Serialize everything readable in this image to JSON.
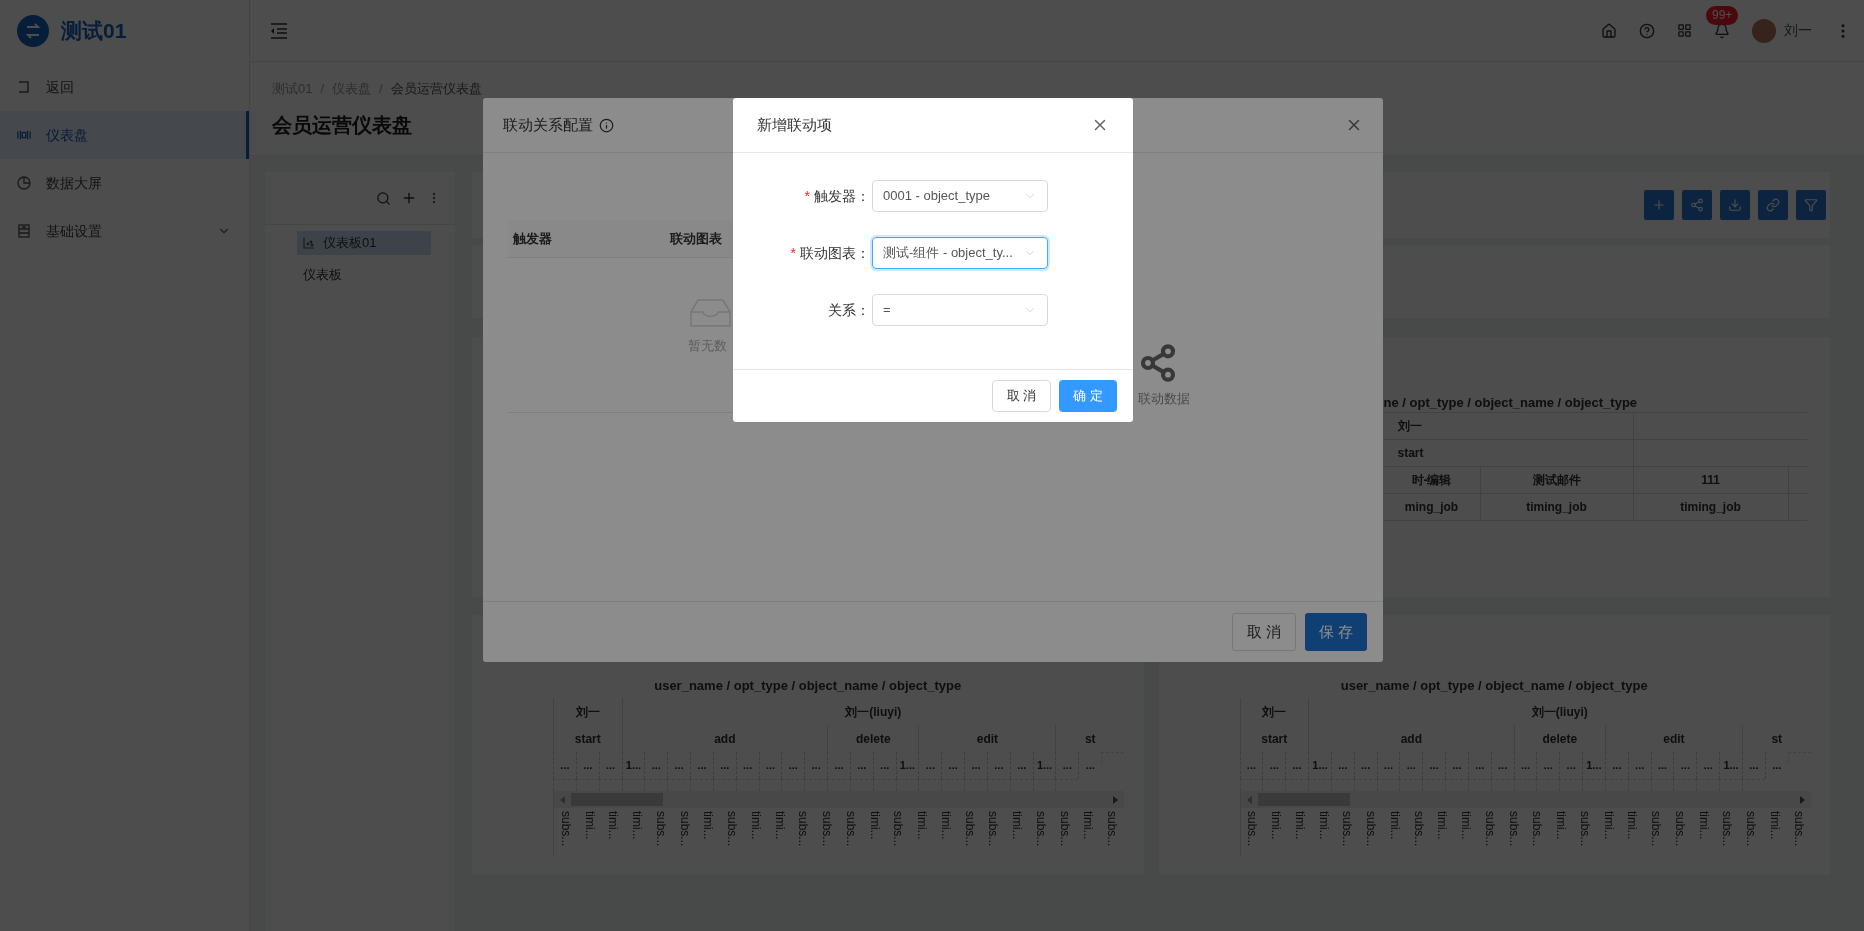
{
  "sidebar": {
    "logo": "测试01",
    "items": [
      {
        "label": "返回",
        "selected": false,
        "has_submenu": false
      },
      {
        "label": "仪表盘",
        "selected": true,
        "has_submenu": false
      },
      {
        "label": "数据大屏",
        "selected": false,
        "has_submenu": false
      },
      {
        "label": "基础设置",
        "selected": false,
        "has_submenu": true
      }
    ]
  },
  "header": {
    "notification_badge": "99+",
    "user_name": "刘一"
  },
  "breadcrumb": [
    {
      "label": "测试01"
    },
    {
      "separator": "/",
      "label": "仪表盘"
    },
    {
      "separator": "/",
      "label": "会员运营仪表盘"
    }
  ],
  "page_title": "会员运营仪表盘",
  "tree": {
    "items": [
      {
        "label": "仪表板01",
        "kind": "dashboard",
        "selected": true
      },
      {
        "label": "仪表板",
        "kind": "folder",
        "selected": false
      }
    ]
  },
  "top_right_chart": {
    "title": "ne / opt_type / object_name / object_type",
    "rows": [
      [
        "刘一"
      ],
      [
        "start"
      ],
      [
        "时-编辑",
        "测试邮件",
        "111"
      ],
      [
        "ming_job",
        "timing_job",
        "timing_job"
      ]
    ]
  },
  "pivot_tables": [
    {
      "title": "user_name / opt_type / object_name / object_type",
      "level_1": [
        "刘一",
        "刘一(liuyi)"
      ],
      "level_2": [
        "start",
        "add",
        "delete",
        "edit",
        "st"
      ],
      "level_3": [
        "...",
        "...",
        "...",
        "1...",
        "...",
        "...",
        "...",
        "...",
        "...",
        "...",
        "...",
        "...",
        "...",
        "...",
        "...",
        "1...",
        "...",
        "...",
        "...",
        "...",
        "...",
        "1...",
        "...",
        "..."
      ],
      "row_labels": [
        "subs...",
        "timi...",
        "timi...",
        "timi...",
        "subs...",
        "subs...",
        "timi...",
        "subs...",
        "timi...",
        "timi...",
        "subs...",
        "subs...",
        "subs...",
        "timi...",
        "subs...",
        "timi...",
        "timi...",
        "subs...",
        "subs...",
        "timi...",
        "subs...",
        "subs...",
        "timi...",
        "subs..."
      ]
    },
    {
      "title": "user_name / opt_type / object_name / object_type",
      "level_1": [
        "刘一",
        "刘一(liuyi)"
      ],
      "level_2": [
        "start",
        "add",
        "delete",
        "edit",
        "st"
      ],
      "level_3": [
        "...",
        "...",
        "...",
        "1...",
        "...",
        "...",
        "...",
        "...",
        "...",
        "...",
        "...",
        "...",
        "...",
        "...",
        "...",
        "1...",
        "...",
        "...",
        "...",
        "...",
        "...",
        "1...",
        "...",
        "..."
      ],
      "row_labels": [
        "subs...",
        "timi...",
        "timi...",
        "timi...",
        "subs...",
        "subs...",
        "timi...",
        "subs...",
        "timi...",
        "timi...",
        "subs...",
        "subs...",
        "subs...",
        "timi...",
        "subs...",
        "timi...",
        "timi...",
        "subs...",
        "subs...",
        "timi...",
        "subs...",
        "subs...",
        "timi...",
        "subs..."
      ]
    }
  ],
  "link_config_dialog": {
    "title": "联动关系配置",
    "columns": [
      "触发器",
      "联动图表"
    ],
    "empty_text": "暂无数",
    "right_empty_text": "联动数据",
    "buttons": [
      {
        "label": "取 消",
        "kind": "default"
      },
      {
        "label": "保 存",
        "kind": "primary"
      }
    ]
  },
  "add_link_dialog": {
    "title": "新增联动项",
    "fields": [
      {
        "required_mark": "*",
        "label": "触发器：",
        "value": "0001 - object_type",
        "focused": false
      },
      {
        "required_mark": "*",
        "label": "联动图表：",
        "value": "测试-组件 - object_ty...",
        "focused": true
      },
      {
        "label": "关系：",
        "value": "=",
        "focused": false
      }
    ],
    "buttons": [
      {
        "label": "取 消",
        "kind": "default"
      },
      {
        "label": "确 定",
        "kind": "primary"
      }
    ]
  }
}
